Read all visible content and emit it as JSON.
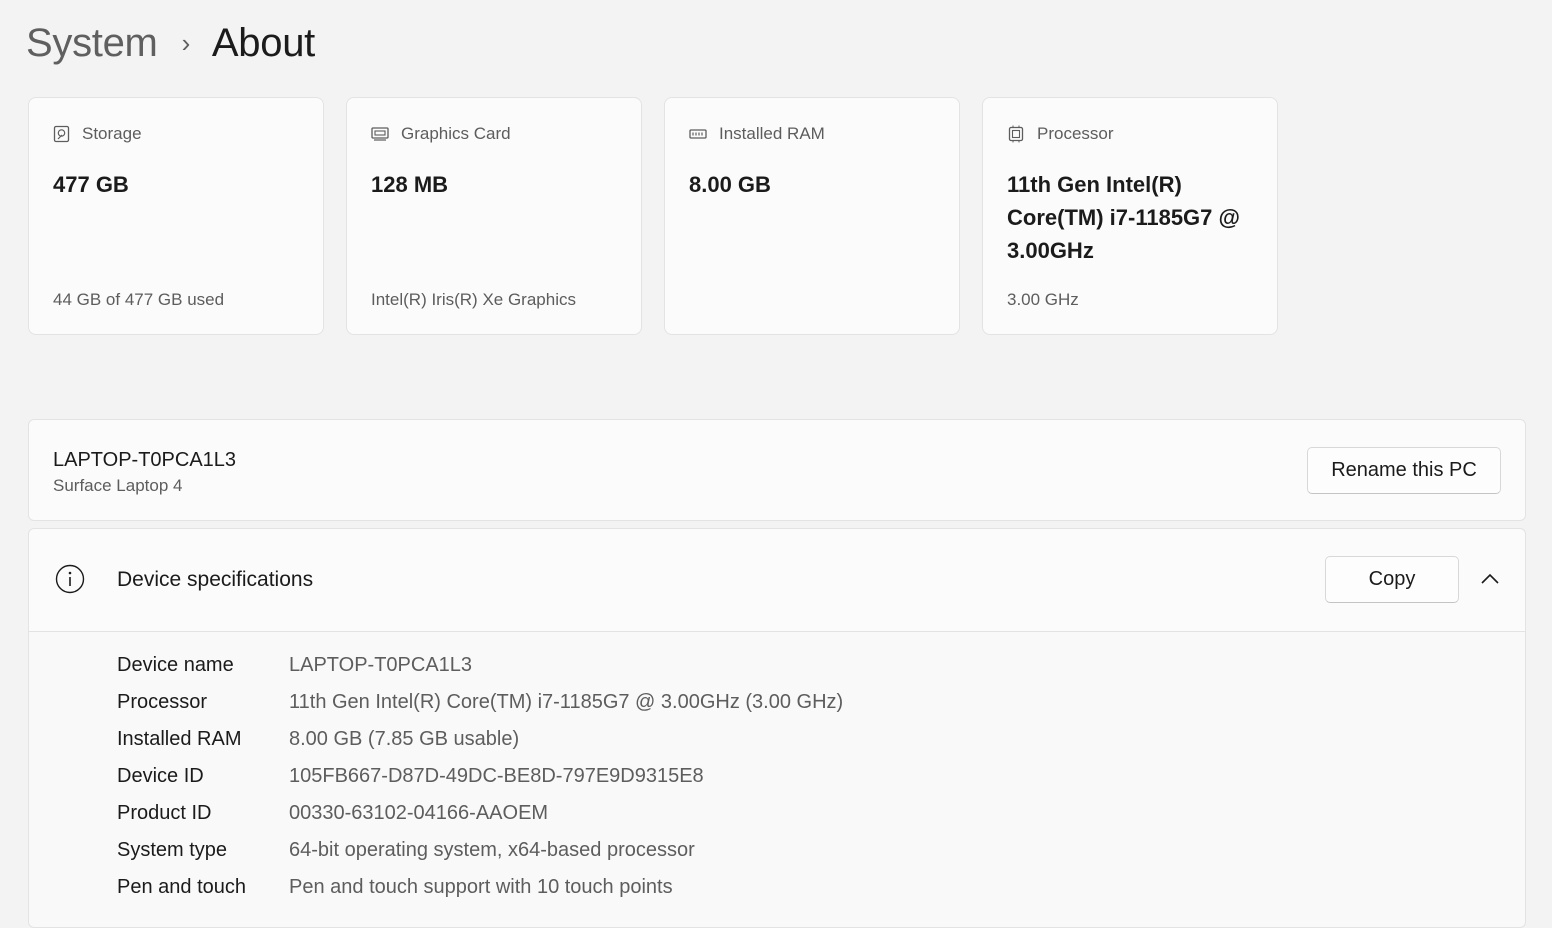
{
  "breadcrumb": {
    "parent": "System",
    "separator": "›",
    "current": "About"
  },
  "cards": [
    {
      "icon": "storage-icon",
      "title": "Storage",
      "value": "477 GB",
      "sub": "44 GB of 477 GB used"
    },
    {
      "icon": "graphics-card-icon",
      "title": "Graphics Card",
      "value": "128 MB",
      "sub": "Intel(R) Iris(R) Xe Graphics"
    },
    {
      "icon": "ram-icon",
      "title": "Installed RAM",
      "value": "8.00 GB",
      "sub": ""
    },
    {
      "icon": "processor-icon",
      "title": "Processor",
      "value": "11th Gen Intel(R) Core(TM) i7-1185G7 @ 3.00GHz",
      "sub": "3.00 GHz"
    }
  ],
  "pc": {
    "name": "LAPTOP-T0PCA1L3",
    "model": "Surface Laptop 4",
    "rename_label": "Rename this PC"
  },
  "specs": {
    "title": "Device specifications",
    "copy_label": "Copy",
    "rows": [
      {
        "label": "Device name",
        "value": "LAPTOP-T0PCA1L3"
      },
      {
        "label": "Processor",
        "value": "11th Gen Intel(R) Core(TM) i7-1185G7 @ 3.00GHz (3.00 GHz)"
      },
      {
        "label": "Installed RAM",
        "value": "8.00 GB (7.85 GB usable)"
      },
      {
        "label": "Device ID",
        "value": "105FB667-D87D-49DC-BE8D-797E9D9315E8"
      },
      {
        "label": "Product ID",
        "value": "00330-63102-04166-AAOEM"
      },
      {
        "label": "System type",
        "value": "64-bit operating system, x64-based processor"
      },
      {
        "label": "Pen and touch",
        "value": "Pen and touch support with 10 touch points"
      }
    ]
  }
}
